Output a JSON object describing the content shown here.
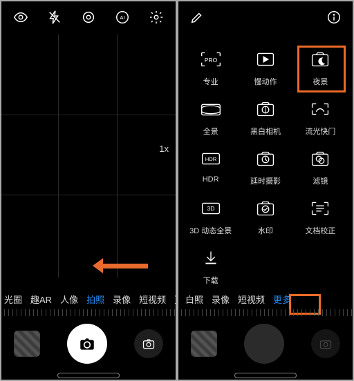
{
  "left": {
    "zoom": "1x",
    "modes": [
      "光圈",
      "趣AR",
      "人像",
      "拍照",
      "录像",
      "短视频",
      "更"
    ],
    "active_mode_index": 3,
    "top_icons": [
      "eye-icon",
      "flash-off-icon",
      "settings-icon",
      "ai-icon",
      "gear-icon"
    ]
  },
  "right": {
    "top_icons": [
      "edit-icon",
      "info-icon"
    ],
    "modes_grid": [
      {
        "icon": "pro-icon",
        "label": "专业"
      },
      {
        "icon": "slowmo-icon",
        "label": "慢动作"
      },
      {
        "icon": "night-icon",
        "label": "夜景"
      },
      {
        "icon": "panorama-icon",
        "label": "全景"
      },
      {
        "icon": "mono-icon",
        "label": "黑白相机"
      },
      {
        "icon": "lightpaint-icon",
        "label": "流光快门"
      },
      {
        "icon": "hdr-icon",
        "label": "HDR"
      },
      {
        "icon": "timelapse-icon",
        "label": "延时摄影"
      },
      {
        "icon": "filter-icon",
        "label": "滤镜"
      },
      {
        "icon": "3dpano-icon",
        "label": "3D 动态全景"
      },
      {
        "icon": "watermark-icon",
        "label": "水印"
      },
      {
        "icon": "docscan-icon",
        "label": "文档校正"
      },
      {
        "icon": "download-icon",
        "label": "下载"
      }
    ],
    "modes": [
      "白照",
      "录像",
      "短视频",
      "更多"
    ],
    "active_mode_index": 3
  },
  "highlights": {
    "night_mode": true,
    "more_tab": true
  },
  "colors": {
    "accent": "#258df2",
    "highlight": "#ea6a28"
  }
}
